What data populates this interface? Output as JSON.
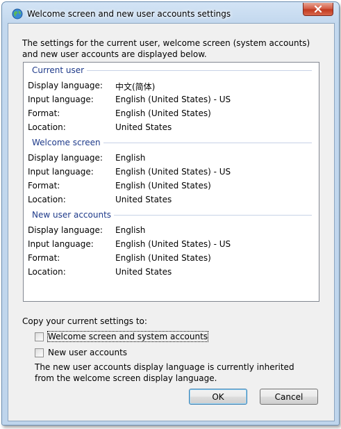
{
  "window": {
    "title": "Welcome screen and new user accounts settings"
  },
  "intro_text": "The settings for the current user, welcome screen (system accounts) and new user accounts are displayed below.",
  "sections": [
    {
      "heading": "Current user",
      "rows": [
        {
          "label": "Display language:",
          "value": "中文(简体)"
        },
        {
          "label": "Input language:",
          "value": "English (United States) - US"
        },
        {
          "label": "Format:",
          "value": "English (United States)"
        },
        {
          "label": "Location:",
          "value": "United States"
        }
      ]
    },
    {
      "heading": "Welcome screen",
      "rows": [
        {
          "label": "Display language:",
          "value": "English"
        },
        {
          "label": "Input language:",
          "value": "English (United States) - US"
        },
        {
          "label": "Format:",
          "value": "English (United States)"
        },
        {
          "label": "Location:",
          "value": "United States"
        }
      ]
    },
    {
      "heading": "New user accounts",
      "rows": [
        {
          "label": "Display language:",
          "value": "English"
        },
        {
          "label": "Input language:",
          "value": "English (United States) - US"
        },
        {
          "label": "Format:",
          "value": "English (United States)"
        },
        {
          "label": "Location:",
          "value": "United States"
        }
      ]
    }
  ],
  "copy": {
    "label": "Copy your current settings to:",
    "options": [
      {
        "label": "Welcome screen and system accounts",
        "checked": false
      },
      {
        "label": "New user accounts",
        "checked": false
      }
    ],
    "note": "The new user accounts display language is currently inherited from the welcome screen display language."
  },
  "buttons": {
    "ok": "OK",
    "cancel": "Cancel"
  },
  "icons": {
    "title": "globe-icon",
    "close": "close-icon"
  }
}
